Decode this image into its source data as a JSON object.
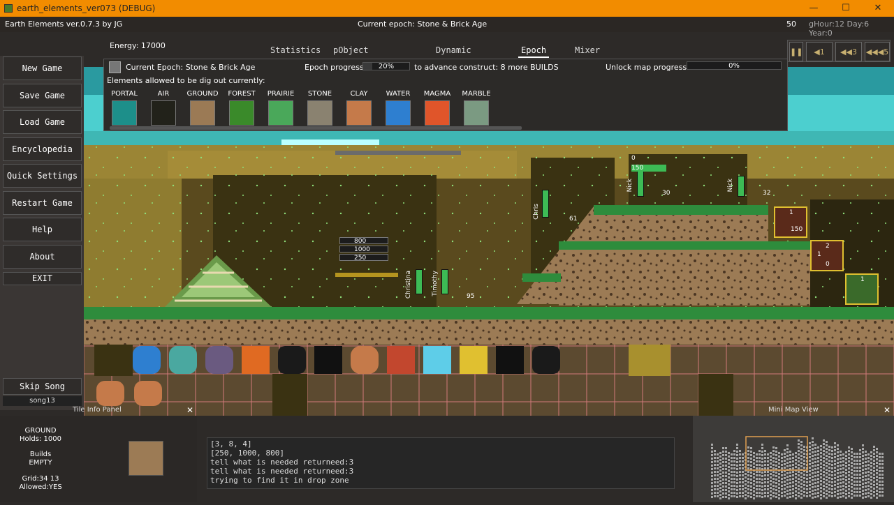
{
  "window": {
    "title": "earth_elements_ver073 (DEBUG)",
    "minimize": "—",
    "maximize": "☐",
    "close": "✕"
  },
  "topbar": {
    "version": "Earth Elements ver.0.7.3 by JG",
    "epoch": "Current epoch: Stone & Brick Age",
    "count": "50",
    "time": "gHour:12 Day:6 Year:0"
  },
  "energy": "Energy: 17000",
  "menu": {
    "new": "New Game",
    "save": "Save Game",
    "load": "Load Game",
    "ency": "Encyclopedia",
    "quick": "Quick Settings",
    "restart": "Restart Game",
    "help": "Help",
    "about": "About",
    "exit": "EXIT",
    "skip": "Skip Song",
    "song": "song13"
  },
  "tabs": {
    "stats": "Statistics",
    "pobj": "pObject informaiton",
    "dyn": "Dynamic Resources",
    "epoch": "Epoch Info",
    "mixer": "Mixer Info"
  },
  "speed": {
    "s1": "1",
    "s3": "3",
    "s5": "5"
  },
  "epoch_panel": {
    "current": "Current Epoch: Stone & Brick Age",
    "allowed": "Elements allowed to be dig out currently:",
    "progress_label": "Epoch progress",
    "progress": "20%",
    "progress_value": 0.2,
    "advance": "to advance construct: 8 more BUILDS",
    "unlock_label": "Unlock map progress",
    "unlock": "0%",
    "unlock_value": 0.0
  },
  "elements": [
    {
      "name": "PORTAL",
      "color": "#1d8f8a"
    },
    {
      "name": "AIR",
      "color": "#22221a"
    },
    {
      "name": "GROUND",
      "color": "#9b7a55"
    },
    {
      "name": "FOREST",
      "color": "#3a8a2a"
    },
    {
      "name": "PRAIRIE",
      "color": "#4aa85a"
    },
    {
      "name": "STONE",
      "color": "#8a8270"
    },
    {
      "name": "CLAY",
      "color": "#c57a4a"
    },
    {
      "name": "WATER",
      "color": "#2e7fd0"
    },
    {
      "name": "MAGMA",
      "color": "#e0552a"
    },
    {
      "name": "MARBLE",
      "color": "#7b9a82"
    }
  ],
  "world": {
    "resources": [
      "800",
      "1000",
      "250"
    ],
    "chars": [
      "Chris",
      "Christina",
      "Timothy",
      "Nick",
      "Nick"
    ],
    "levels": [
      "61",
      "95",
      "32",
      "30"
    ],
    "hp": [
      "1652",
      "1553",
      "1653",
      "1812",
      "1523",
      "1882"
    ],
    "tower": [
      "0",
      "150"
    ],
    "boxes": [
      "1",
      "150",
      "2",
      "1",
      "0",
      "1"
    ]
  },
  "tile": {
    "panel": "Tile Info Panel",
    "type": "GROUND",
    "holds": "Holds: 1000",
    "builds": "Builds",
    "builds_val": "EMPTY",
    "grid": "Grid:34 13",
    "allowed": "Allowed:YES",
    "close": "✕"
  },
  "console": [
    "[3, 8, 4]",
    "[250, 1000, 800]",
    "tell what is needed returneed:3",
    "tell what is needed returneed:3",
    "trying to find it in drop zone"
  ],
  "minimap": {
    "title": "Mini Map View",
    "close": "✕"
  }
}
